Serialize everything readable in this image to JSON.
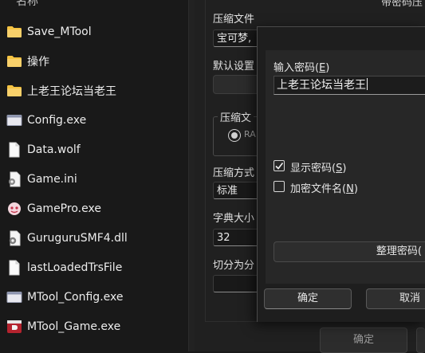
{
  "file_list": {
    "column_header": "名称",
    "items": [
      {
        "name": "Save_MTool",
        "icon": "folder-icon"
      },
      {
        "name": "操作",
        "icon": "folder-icon"
      },
      {
        "name": "上老王论坛当老王",
        "icon": "folder-icon"
      },
      {
        "name": "Config.exe",
        "icon": "app-window-icon"
      },
      {
        "name": "Data.wolf",
        "icon": "document-icon"
      },
      {
        "name": "Game.ini",
        "icon": "settings-file-icon"
      },
      {
        "name": "GamePro.exe",
        "icon": "game-app-icon"
      },
      {
        "name": "GuruguruSMF4.dll",
        "icon": "dll-gear-icon"
      },
      {
        "name": "lastLoadedTrsFile",
        "icon": "document-icon"
      },
      {
        "name": "MTool_Config.exe",
        "icon": "app-window-icon"
      },
      {
        "name": "MTool_Game.exe",
        "icon": "red-app-icon"
      }
    ]
  },
  "compress_dialog": {
    "title_fragment": "带密码压",
    "archive_label": "压缩文件",
    "archive_value": "宝可梦,",
    "default_settings_label": "默认设置",
    "format_group_label": "压缩文",
    "format_option": "RA",
    "method_label": "压缩方式",
    "method_value": "标准",
    "dict_label": "字典大小",
    "dict_value": "32",
    "split_label": "切分为分",
    "ok_label": "确定"
  },
  "password_dialog": {
    "enter_password_label": "输入密码(",
    "enter_password_key": "E",
    "password_value": "上老王论坛当老王",
    "show_password_label": "显示密码(",
    "show_password_key": "S",
    "show_password_checked": true,
    "encrypt_filenames_label": "加密文件名(",
    "encrypt_filenames_key": "N",
    "encrypt_filenames_checked": false,
    "manage_passwords_label": "整理密码(",
    "ok_label": "确定",
    "cancel_label": "取消"
  },
  "colors": {
    "background": "#191919",
    "dialog": "#202020",
    "folder": "#f5c342"
  }
}
